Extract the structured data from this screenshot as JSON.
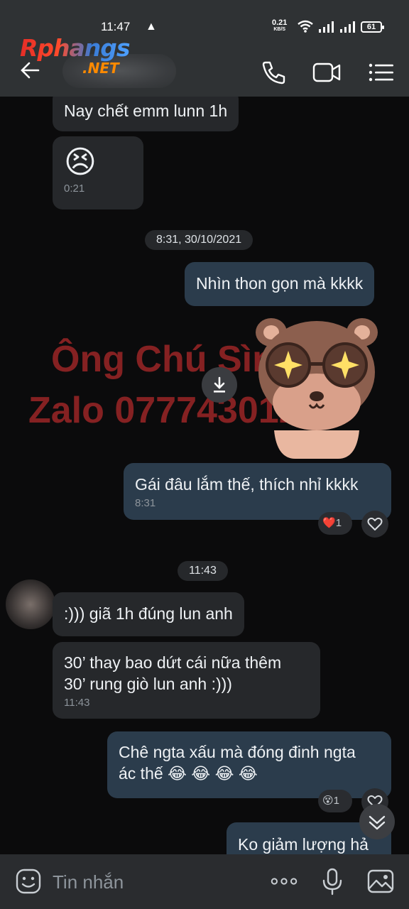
{
  "status_bar": {
    "time": "11:47",
    "net_speed": "0.21",
    "net_unit": "KB/S",
    "battery": "61"
  },
  "header": {
    "logo_main": "Rphangs",
    "logo_sub": ".NET"
  },
  "watermark": {
    "line1": "Ông Chú Sìn Sú",
    "line2": "Zalo 0777430123"
  },
  "messages": [
    {
      "side": "in",
      "text": "Nay chết emm lunn 1h"
    },
    {
      "side": "in",
      "type": "emoji",
      "emoji": "😣",
      "time": "0:21"
    },
    {
      "type": "date",
      "text": "8:31, 30/10/2021"
    },
    {
      "side": "out",
      "text": "Nhìn thon gọn mà kkkk"
    },
    {
      "side": "out",
      "type": "sticker",
      "sticker": "bear-with-star-glasses"
    },
    {
      "side": "out",
      "text": "Gái đâu lắm thế, thích nhỉ kkkk",
      "time": "8:31",
      "reaction": "❤️",
      "reaction_count": "1"
    },
    {
      "type": "date",
      "text": "11:43"
    },
    {
      "side": "in",
      "text": ":))) giã 1h đúng lun anh"
    },
    {
      "side": "in",
      "text_line1": "30’ thay bao dứt cái nữa thêm",
      "text_line2": "30’ rung giò lun anh :)))",
      "time": "11:43"
    },
    {
      "side": "out",
      "text_line1": "Chê ngta xấu mà đóng đinh ngta",
      "text_line2": "ác thế 😂 😂 😂 😂",
      "reaction": "😵",
      "reaction_count": "1"
    },
    {
      "side": "out",
      "text": "Ko giảm lượng hả"
    }
  ],
  "composer": {
    "placeholder": "Tin nhắn"
  },
  "colors": {
    "incoming_bubble": "#26282b",
    "outgoing_bubble": "#2b3c4c",
    "chat_background": "#0b0b0c",
    "bar_background": "#2f3234"
  }
}
